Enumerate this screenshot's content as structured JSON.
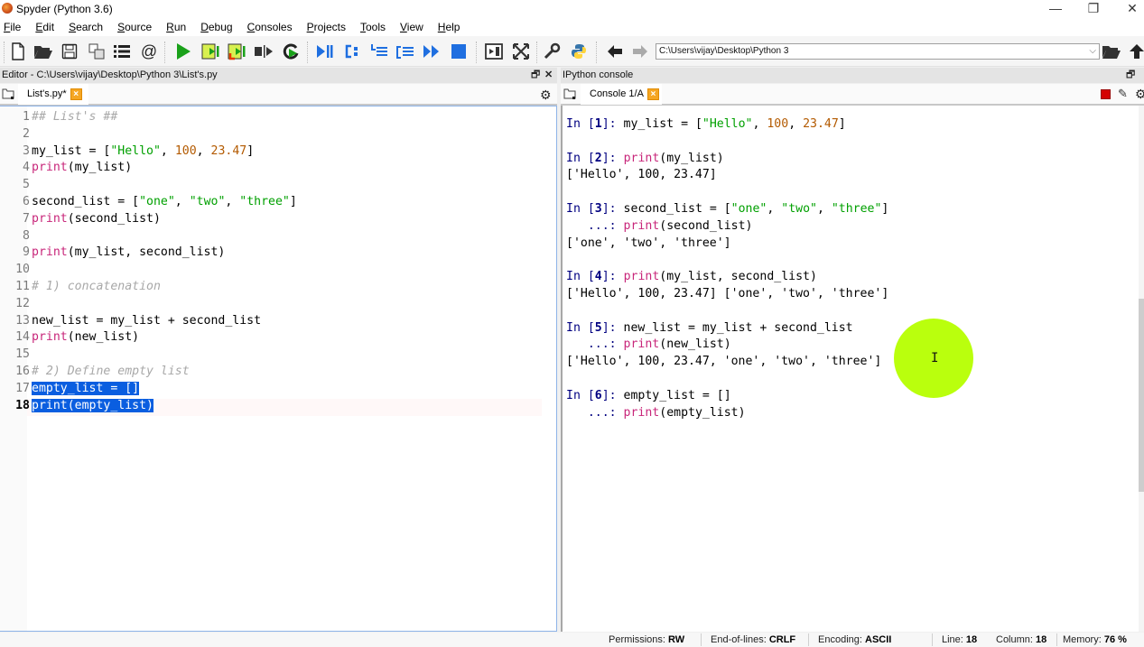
{
  "window": {
    "title": "Spyder (Python 3.6)",
    "controls": {
      "minimize": "—",
      "maximize": "❐",
      "close": "✕"
    }
  },
  "menubar": {
    "items": [
      "File",
      "Edit",
      "Search",
      "Source",
      "Run",
      "Debug",
      "Consoles",
      "Projects",
      "Tools",
      "View",
      "Help"
    ]
  },
  "toolbar": {
    "icons": [
      "new-file",
      "open-file",
      "save-file",
      "save-all",
      "outline",
      "email",
      "run",
      "run-cell",
      "run-cell-advance",
      "run-selection",
      "rerun",
      "debug",
      "step",
      "step-into",
      "step-return",
      "continue",
      "stop-debug",
      "maximize-pane",
      "fullscreen",
      "preferences",
      "python-path",
      "back",
      "forward",
      "browse-folder",
      "parent-dir"
    ],
    "working_dir": "C:\\Users\\vijay\\Desktop\\Python 3"
  },
  "editor": {
    "header": "Editor - C:\\Users\\vijay\\Desktop\\Python 3\\List's.py",
    "tab_label": "List's.py*",
    "current_line": 18,
    "lines": [
      {
        "n": "1",
        "t": "## List's ##"
      },
      {
        "n": "2",
        "t": ""
      },
      {
        "n": "3",
        "t": "my_list = [\"Hello\", 100, 23.47]"
      },
      {
        "n": "4",
        "t": "print(my_list)"
      },
      {
        "n": "5",
        "t": ""
      },
      {
        "n": "6",
        "t": "second_list = [\"one\", \"two\", \"three\"]"
      },
      {
        "n": "7",
        "t": "print(second_list)"
      },
      {
        "n": "8",
        "t": ""
      },
      {
        "n": "9",
        "t": "print(my_list, second_list)"
      },
      {
        "n": "10",
        "t": ""
      },
      {
        "n": "11",
        "t": "# 1) concatenation"
      },
      {
        "n": "12",
        "t": ""
      },
      {
        "n": "13",
        "t": "new_list = my_list + second_list"
      },
      {
        "n": "14",
        "t": "print(new_list)"
      },
      {
        "n": "15",
        "t": ""
      },
      {
        "n": "16",
        "t": "# 2) Define empty list"
      },
      {
        "n": "17",
        "t": "empty_list = []"
      },
      {
        "n": "18",
        "t": "print(empty_list)"
      }
    ]
  },
  "console": {
    "header": "IPython console",
    "tab_label": "Console 1/A",
    "entries": [
      {
        "in": "1",
        "code": [
          "my_list = [\"Hello\", 100, 23.47]"
        ],
        "out": ""
      },
      {
        "in": "2",
        "code": [
          "print(my_list)"
        ],
        "out": "['Hello', 100, 23.47]"
      },
      {
        "in": "3",
        "code": [
          "second_list = [\"one\", \"two\", \"three\"]",
          "print(second_list)"
        ],
        "out": "['one', 'two', 'three']"
      },
      {
        "in": "4",
        "code": [
          "print(my_list, second_list)"
        ],
        "out": "['Hello', 100, 23.47] ['one', 'two', 'three']"
      },
      {
        "in": "5",
        "code": [
          "new_list = my_list + second_list",
          "print(new_list)"
        ],
        "out": "['Hello', 100, 23.47, 'one', 'two', 'three']"
      },
      {
        "in": "6",
        "code": [
          "empty_list = []",
          "print(empty_list)"
        ],
        "out": ""
      }
    ],
    "continuation_prompt": "...:"
  },
  "statusbar": {
    "permissions_label": "Permissions:",
    "permissions": "RW",
    "eol_label": "End-of-lines:",
    "eol": "CRLF",
    "encoding_label": "Encoding:",
    "encoding": "ASCII",
    "line_label": "Line:",
    "line": "18",
    "column_label": "Column:",
    "column": "18",
    "memory_label": "Memory:",
    "memory": "76 %"
  },
  "colors": {
    "keyword": "#c8267a",
    "string": "#00a000",
    "number": "#b35a00",
    "comment": "#a8a8a8",
    "selection": "#0a5ee0",
    "prompt": "#000080",
    "cursor_highlight": "#b6ff00",
    "tab_close": "#f5a623"
  }
}
